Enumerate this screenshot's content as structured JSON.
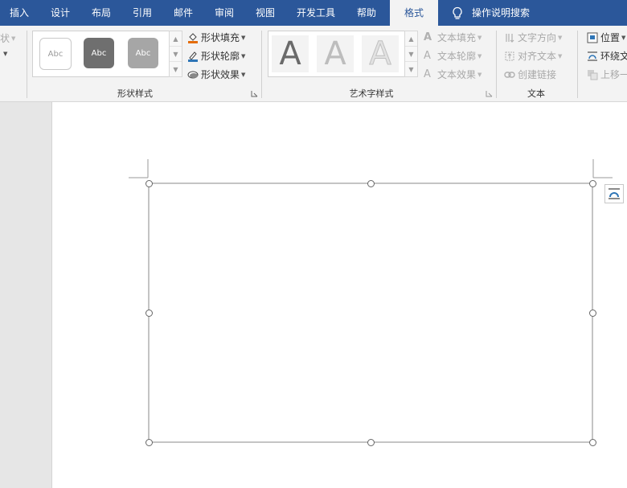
{
  "tabs": [
    {
      "label": "插入",
      "active": false
    },
    {
      "label": "设计",
      "active": false
    },
    {
      "label": "布局",
      "active": false
    },
    {
      "label": "引用",
      "active": false
    },
    {
      "label": "邮件",
      "active": false
    },
    {
      "label": "审阅",
      "active": false
    },
    {
      "label": "视图",
      "active": false
    },
    {
      "label": "开发工具",
      "active": false
    },
    {
      "label": "帮助",
      "active": false
    },
    {
      "label": "格式",
      "active": true
    }
  ],
  "tell_me": "操作说明搜索",
  "insert_shapes": {
    "partial_label": "状"
  },
  "shape_styles": {
    "group_label": "形状样式",
    "swatches": [
      {
        "text": "Abc",
        "fill": "#ffffff",
        "border": "#c9c9c9",
        "text_color": "#9c9c9c"
      },
      {
        "text": "Abc",
        "fill": "#6f6f6f",
        "border": "#6f6f6f",
        "text_color": "#ffffff"
      },
      {
        "text": "Abc",
        "fill": "#a6a6a6",
        "border": "#a6a6a6",
        "text_color": "#ffffff"
      }
    ],
    "fill": "形状填充",
    "outline": "形状轮廓",
    "effects": "形状效果"
  },
  "wordart_styles": {
    "group_label": "艺术字样式",
    "letters": [
      "A",
      "A",
      "A"
    ],
    "text_fill": "文本填充",
    "text_outline": "文本轮廓",
    "text_effects": "文本效果"
  },
  "text_group": {
    "group_label": "文本",
    "direction": "文字方向",
    "align": "对齐文本",
    "link": "创建链接"
  },
  "arrange": {
    "position": "位置",
    "wrap": "环绕文",
    "bring_forward": "上移一"
  },
  "colors": {
    "tab_bar": "#2b579a",
    "ribbon": "#f3f3f3"
  }
}
